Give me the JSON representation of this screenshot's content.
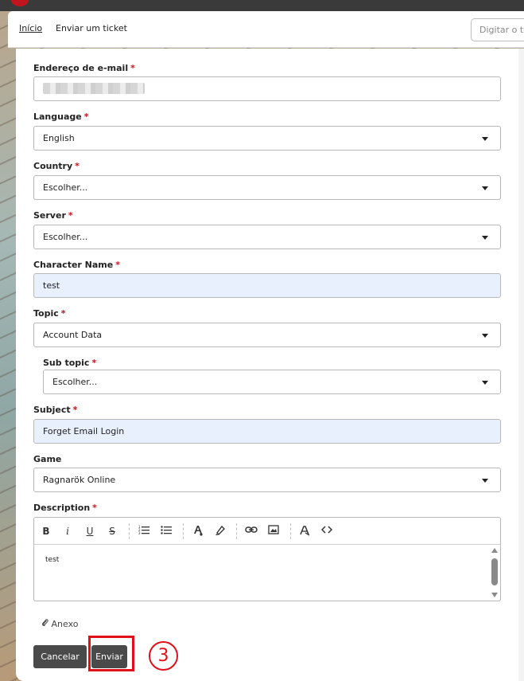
{
  "nav": {
    "home": "Início",
    "submit_ticket": "Enviar um ticket",
    "search_placeholder": "Digitar o te"
  },
  "form": {
    "email": {
      "label": "Endereço de e-mail",
      "required": "*",
      "value": ""
    },
    "language": {
      "label": "Language",
      "required": "*",
      "value": "English"
    },
    "country": {
      "label": "Country",
      "required": "*",
      "value": "Escolher..."
    },
    "server": {
      "label": "Server",
      "required": "*",
      "value": "Escolher..."
    },
    "character_name": {
      "label": "Character Name",
      "required": "*",
      "value": "test"
    },
    "topic": {
      "label": "Topic",
      "required": "*",
      "value": "Account Data"
    },
    "sub_topic": {
      "label": "Sub topic",
      "required": "*",
      "value": "Escolher..."
    },
    "subject": {
      "label": "Subject",
      "required": "*",
      "value": "Forget Email Login"
    },
    "game": {
      "label": "Game",
      "value": "Ragnarök Online"
    },
    "description": {
      "label": "Description",
      "required": "*",
      "value": "test"
    }
  },
  "toolbar": {
    "bold": "B",
    "italic": "i",
    "underline": "U",
    "strike": "S"
  },
  "attachment_label": "Anexo",
  "buttons": {
    "cancel": "Cancelar",
    "submit": "Enviar"
  },
  "annotation": {
    "step": "3",
    "color": "#e0101a"
  },
  "colors": {
    "required": "#c0151e",
    "button": "#4a4a4a",
    "autofill": "#e8f0fe"
  }
}
